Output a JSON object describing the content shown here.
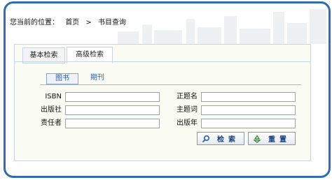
{
  "breadcrumb": {
    "prefix": "您当前的位置：",
    "home": "首页",
    "separator": ">",
    "current": "书目查询"
  },
  "tabs": [
    {
      "label": "基本检索",
      "active": false
    },
    {
      "label": "高级检索",
      "active": true
    }
  ],
  "subtabs": [
    {
      "label": "图书",
      "active": true
    },
    {
      "label": "期刊",
      "active": false
    }
  ],
  "form": {
    "isbn_label": "ISBN",
    "publisher_label": "出版社",
    "author_label": "责任者",
    "title_label": "正题名",
    "subject_label": "主题词",
    "year_label": "出版年",
    "isbn_value": "",
    "publisher_value": "",
    "author_value": "",
    "title_value": "",
    "subject_value": "",
    "year_value": ""
  },
  "buttons": {
    "search_label": "检索",
    "reset_label": "重置"
  },
  "colors": {
    "frame": "#2f6eaa",
    "panel": "#fafbf2",
    "link": "#2b5fa8"
  }
}
